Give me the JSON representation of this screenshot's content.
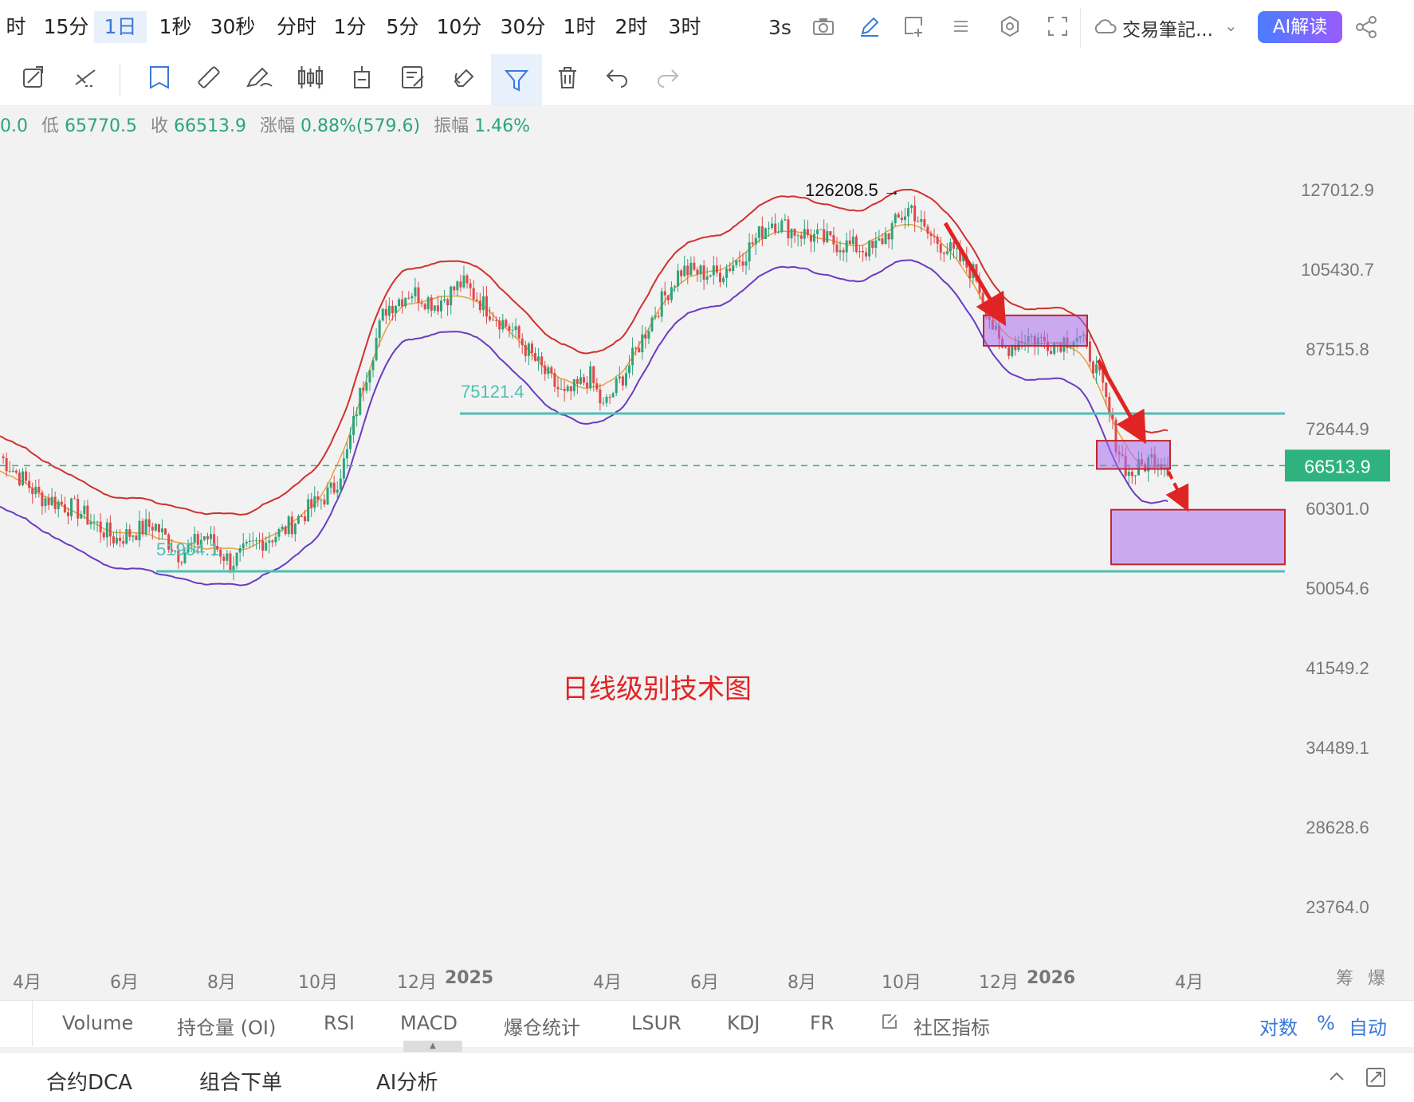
{
  "top_bar": {
    "intervals": [
      "时",
      "15分",
      "1日",
      "1秒",
      "30秒",
      "分时",
      "1分",
      "5分",
      "10分",
      "30分",
      "1时",
      "2时",
      "3时"
    ],
    "active_interval": "1日",
    "refresh": "3s",
    "journal_label": "交易筆記...",
    "ai_button": "AI解读"
  },
  "ohlc": {
    "open_tail": "0.0",
    "low_label": "低",
    "low": "65770.5",
    "close_label": "收",
    "close": "66513.9",
    "change_label": "涨幅",
    "change": "0.88%(579.6)",
    "amp_label": "振幅",
    "amp": "1.46%"
  },
  "price_axis": [
    "127012.9",
    "105430.7",
    "87515.8",
    "72644.9",
    "66513.9",
    "60301.0",
    "50054.6",
    "41549.2",
    "34489.1",
    "28628.6",
    "23764.0"
  ],
  "x_axis": [
    {
      "label": "4月",
      "bold": false
    },
    {
      "label": "6月",
      "bold": false
    },
    {
      "label": "8月",
      "bold": false
    },
    {
      "label": "10月",
      "bold": false
    },
    {
      "label": "12月",
      "bold": false
    },
    {
      "label": "2025",
      "bold": true
    },
    {
      "label": "4月",
      "bold": false
    },
    {
      "label": "6月",
      "bold": false
    },
    {
      "label": "8月",
      "bold": false
    },
    {
      "label": "10月",
      "bold": false
    },
    {
      "label": "12月",
      "bold": false
    },
    {
      "label": "2026",
      "bold": true
    },
    {
      "label": "4月",
      "bold": false
    }
  ],
  "axis_chips": [
    "筹",
    "爆"
  ],
  "indicator_tabs": [
    "Volume",
    "持仓量 (OI)",
    "RSI",
    "MACD",
    "爆仓统计",
    "LSUR",
    "KDJ",
    "FR",
    "社区指标"
  ],
  "scale_options": [
    "对数",
    "%",
    "自动"
  ],
  "bottom_tabs": [
    "合约DCA",
    "组合下单",
    "AI分析"
  ],
  "chart_data": {
    "type": "candlestick",
    "scale": "log",
    "annotation_title": "日线级别技术图",
    "high_marker": "126208.5",
    "last_price": 66513.9,
    "support_levels": [
      {
        "label": "75121.4",
        "value": 75121.4
      },
      {
        "label": "51954.1",
        "value": 51954.1
      }
    ],
    "boxes": [
      {
        "from": "2025-11",
        "to": "2026-01",
        "low": 88000,
        "high": 94500
      },
      {
        "from": "2026-02",
        "to": "2026-02-end",
        "low": 66000,
        "high": 70500
      },
      {
        "from": "2026-02",
        "to": "2026-04",
        "low": 52800,
        "high": 60000
      }
    ],
    "series": [
      {
        "name": "upper_band",
        "color": "#d0312d"
      },
      {
        "name": "mid_band",
        "color": "#e9a040"
      },
      {
        "name": "lower_band",
        "color": "#6a3bc0"
      }
    ],
    "price_path": [
      [
        0,
        68000
      ],
      [
        0.03,
        62000
      ],
      [
        0.06,
        60000
      ],
      [
        0.09,
        56000
      ],
      [
        0.12,
        58000
      ],
      [
        0.14,
        54000
      ],
      [
        0.16,
        56500
      ],
      [
        0.18,
        53000
      ],
      [
        0.2,
        55500
      ],
      [
        0.22,
        57000
      ],
      [
        0.24,
        60000
      ],
      [
        0.26,
        63000
      ],
      [
        0.27,
        68000
      ],
      [
        0.28,
        78000
      ],
      [
        0.3,
        96000
      ],
      [
        0.32,
        100000
      ],
      [
        0.34,
        97000
      ],
      [
        0.36,
        102000
      ],
      [
        0.38,
        96000
      ],
      [
        0.4,
        91000
      ],
      [
        0.42,
        84000
      ],
      [
        0.44,
        78000
      ],
      [
        0.46,
        82000
      ],
      [
        0.47,
        76000
      ],
      [
        0.49,
        84000
      ],
      [
        0.51,
        95000
      ],
      [
        0.53,
        105000
      ],
      [
        0.56,
        104000
      ],
      [
        0.58,
        109000
      ],
      [
        0.6,
        118000
      ],
      [
        0.62,
        115000
      ],
      [
        0.65,
        112000
      ],
      [
        0.68,
        110000
      ],
      [
        0.7,
        118000
      ],
      [
        0.71,
        122000
      ],
      [
        0.72,
        115000
      ],
      [
        0.74,
        110000
      ],
      [
        0.76,
        104000
      ],
      [
        0.77,
        95000
      ],
      [
        0.78,
        87000
      ],
      [
        0.8,
        90000
      ],
      [
        0.82,
        88500
      ],
      [
        0.84,
        90000
      ],
      [
        0.85,
        86000
      ],
      [
        0.86,
        79000
      ],
      [
        0.87,
        70000
      ],
      [
        0.88,
        65000
      ],
      [
        0.9,
        68000
      ],
      [
        0.91,
        66513.9
      ]
    ]
  }
}
